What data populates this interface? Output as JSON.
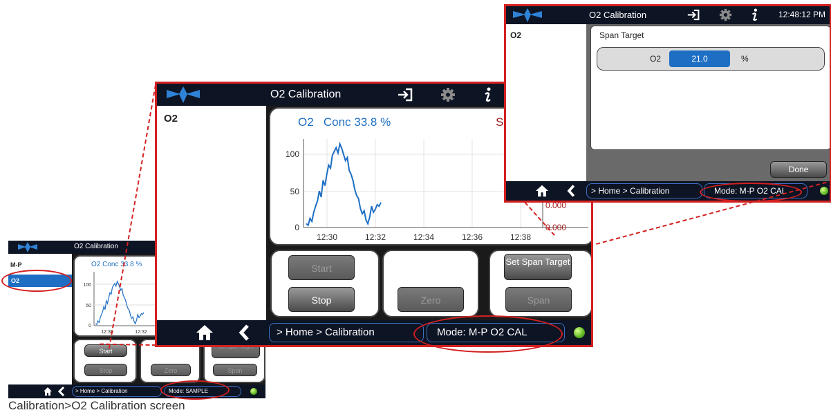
{
  "small": {
    "title": "O2 Calibration",
    "sidebar": [
      "M-P",
      "O2"
    ],
    "chart_label": "O2   Conc 33.8 %",
    "y_ticks": [
      "100",
      "50",
      "0"
    ],
    "x_ticks": [
      "12:30",
      "12:32"
    ],
    "buttons": {
      "start": "Start",
      "stop": "Stop",
      "zero": "Zero",
      "span_target": "Set Span Target",
      "span": "Span"
    },
    "crumb": "> Home > Calibration",
    "mode": "Mode: SAMPLE"
  },
  "main": {
    "title": "O2 Calibration",
    "sidebar": [
      "O2"
    ],
    "chart_label": "O2   Conc 33.8 %",
    "chart_label_right": "S",
    "y_ticks": [
      "100",
      "50",
      "0"
    ],
    "x_ticks": [
      "12:30",
      "12:32",
      "12:34",
      "12:36",
      "12:38"
    ],
    "right_ticks": [
      "0.000",
      "0.000"
    ],
    "buttons": {
      "start": "Start",
      "stop": "Stop",
      "zero": "Zero",
      "span_target": "Set Span Target",
      "span": "Span"
    },
    "crumb": "> Home > Calibration",
    "mode": "Mode: M-P O2 CAL"
  },
  "span": {
    "title": "O2 Calibration",
    "time": "12:48:12 PM",
    "sidebar": [
      "O2"
    ],
    "section": "Span Target",
    "field_label": "O2",
    "field_value": "21.0",
    "field_unit": "%",
    "done": "Done",
    "crumb": "> Home > Calibration",
    "mode": "Mode: M-P O2 CAL"
  },
  "caption": "Calibration>O2 Calibration screen",
  "colors": {
    "accent": "#1e6fc4",
    "highlight": "#d42020",
    "bar": "#0d1424"
  },
  "chart_data": {
    "type": "line",
    "title": "O2   Conc 33.8 %",
    "xlabel": "",
    "ylabel": "",
    "x_ticks": [
      "12:30",
      "12:32",
      "12:34",
      "12:36",
      "12:38"
    ],
    "ylim": [
      0,
      120
    ],
    "series": [
      {
        "values": [
          5,
          3,
          12,
          8,
          20,
          28,
          35,
          48,
          40,
          62,
          55,
          70,
          82,
          78,
          95,
          100,
          105,
          98,
          110,
          104,
          96,
          88,
          92,
          75,
          70,
          62,
          50,
          42,
          38,
          25,
          18,
          22,
          10,
          5,
          14,
          28,
          20,
          24,
          30,
          28,
          33
        ]
      }
    ]
  }
}
